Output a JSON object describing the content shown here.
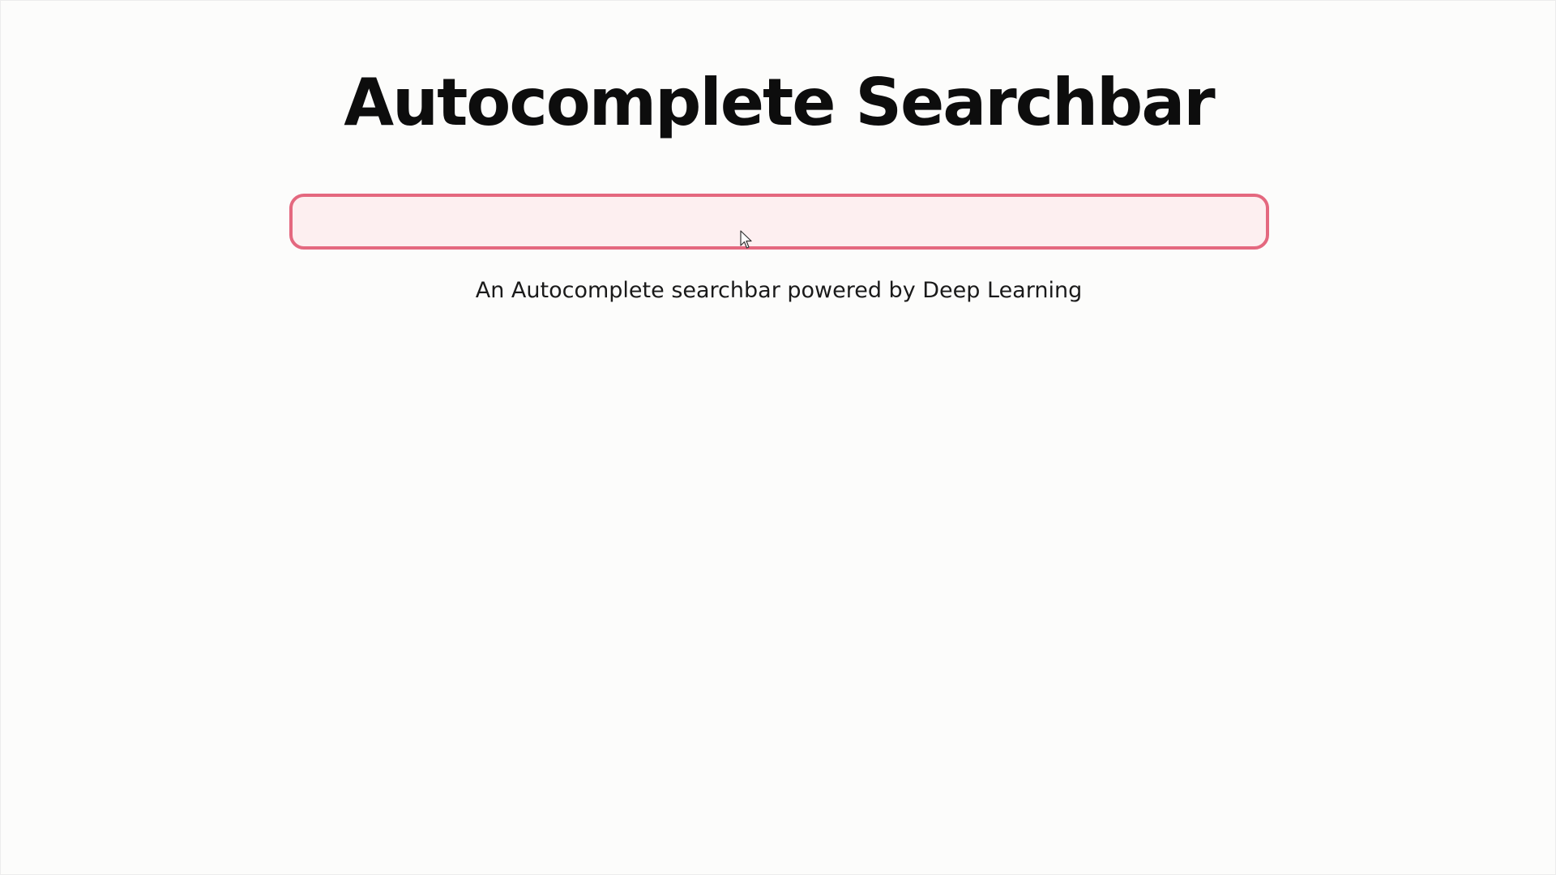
{
  "page": {
    "title": "Autocomplete Searchbar",
    "subtitle": "An Autocomplete searchbar powered by Deep Learning"
  },
  "search": {
    "value": "",
    "placeholder": ""
  },
  "colors": {
    "background": "#fcfcfb",
    "search_border": "#e4687f",
    "search_fill": "#fdeff0",
    "title_text": "#0d0d0d"
  },
  "icons": {
    "cursor": "mouse-pointer-icon"
  }
}
